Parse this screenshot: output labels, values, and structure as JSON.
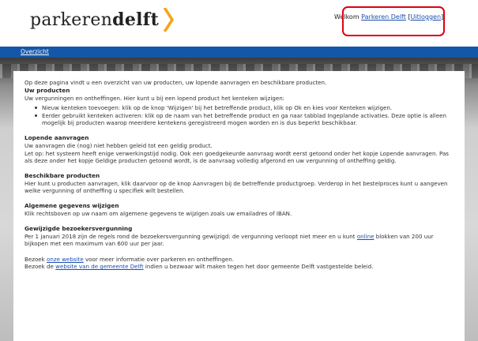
{
  "header": {
    "logo_regular": "parkeren",
    "logo_bold": "delft",
    "welcome_prefix": "Welkom ",
    "user_name": "Parkeren Delft",
    "logout_open": "[",
    "logout_label": "Uitloggen",
    "logout_close": "]"
  },
  "nav": {
    "overview_label": "Overzicht"
  },
  "content": {
    "intro": "Op deze pagina vindt u een overzicht van uw producten, uw lopende aanvragen en beschikbare producten.",
    "products": {
      "title": "Uw producten",
      "text": "Uw vergunningen en ontheffingen. Hier kunt u bij een lopend product het kenteken wijzigen:",
      "bullets": [
        "Nieuw kenteken toevoegen: klik op de knop 'Wijzigen' bij het betreffende product, klik op Ok en kies voor Kenteken wijzigen.",
        "Eerder gebruikt kenteken activeren: klik op de naam van het betreffende product en ga naar tabblad Ingeplande activaties. Deze optie is alleen mogelijk bij producten waarop meerdere kentekens geregistreerd mogen worden en is dus beperkt beschikbaar."
      ]
    },
    "requests": {
      "title": "Lopende aanvragen",
      "line1": "Uw aanvragen die (nog) niet hebben geleid tot een geldig product.",
      "line2": "Let op: het systeem heeft enige verwerkingstijd nodig. Ook een goedgekeurde aanvraag wordt eerst getoond onder het kopje Lopende aanvragen. Pas als deze onder het kopje Geldige producten getoond wordt, is de aanvraag volledig afgerond en uw vergunning of ontheffing geldig."
    },
    "available": {
      "title": "Beschikbare producten",
      "text": "Hier kunt u producten aanvragen, klik daarvoor op de knop Aanvragen bij de betreffende productgroep. Verderop in het bestelproces kunt u aangeven welke vergunning of ontheffing u specifiek wilt bestellen."
    },
    "general": {
      "title": "Algemene gegevens wijzigen",
      "text": "Klik rechtsboven op uw naam om algemene gegevens te wijzigen zoals uw emailadres of IBAN."
    },
    "visitor": {
      "title": "Gewijzigde bezoekersvergunning",
      "text_before": "Per 1 januari 2018 zijn de regels rond de bezoekersvergunning gewijzigd: de vergunning verloopt niet meer en u kunt ",
      "link": "online",
      "text_after": " blokken van 200 uur bijkopen met een maximum van 600 uur per jaar."
    },
    "footer1": {
      "before": "Bezoek ",
      "link": "onze website",
      "after": " voor meer informatie over parkeren en ontheffingen."
    },
    "footer2": {
      "before": "Bezoek de ",
      "link": "website van de gemeente Delft",
      "after": " indien u bezwaar wilt maken tegen het door gemeente Delft vastgestelde beleid."
    }
  },
  "colors": {
    "nav_blue": "#1457a8",
    "logo_accent": "#f5a51c",
    "highlight_red": "#e00012",
    "link_blue": "#1a4fb0"
  }
}
